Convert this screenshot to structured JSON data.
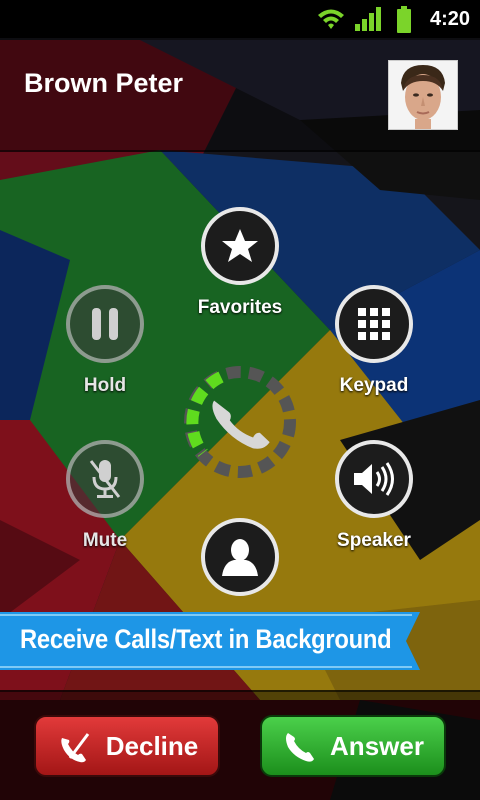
{
  "status_bar": {
    "time": "4:20"
  },
  "caller": {
    "name": "Brown Peter"
  },
  "controls": {
    "favorites": "Favorites",
    "hold": "Hold",
    "keypad": "Keypad",
    "mute": "Mute",
    "speaker": "Speaker"
  },
  "banner": {
    "text": "Receive Calls/Text in Background"
  },
  "actions": {
    "decline": "Decline",
    "answer": "Answer"
  },
  "colors": {
    "decline": "#d32f2f",
    "answer": "#2eb82e",
    "banner": "#1e96e6",
    "ring_active": "#5fdc1e"
  }
}
